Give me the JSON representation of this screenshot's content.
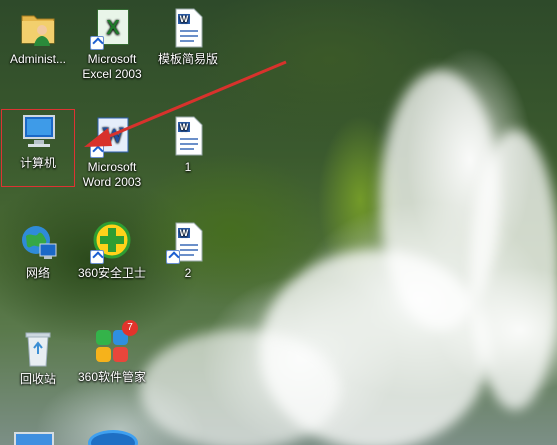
{
  "desktop": {
    "icons": [
      {
        "label": "Administ..."
      },
      {
        "label": "Microsoft\nExcel 2003"
      },
      {
        "label": "模板简易版"
      },
      {
        "label": "计算机"
      },
      {
        "label": "Microsoft\nWord 2003"
      },
      {
        "label": "1"
      },
      {
        "label": "网络"
      },
      {
        "label": "360安全卫士"
      },
      {
        "label": "2"
      },
      {
        "label": "回收站"
      },
      {
        "label": "360软件管家"
      }
    ],
    "badge_count": "7",
    "annotation_color": "#d8322c"
  }
}
